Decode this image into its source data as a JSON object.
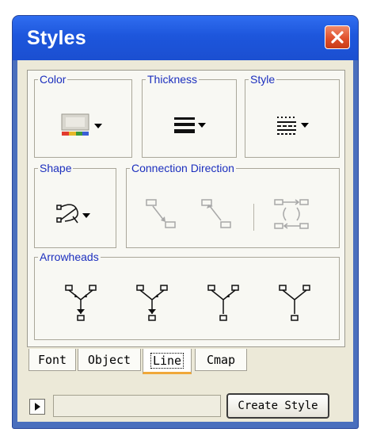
{
  "window": {
    "title": "Styles"
  },
  "groups": {
    "color": "Color",
    "thickness": "Thickness",
    "style": "Style",
    "shape": "Shape",
    "connection": "Connection Direction",
    "arrowheads": "Arrowheads"
  },
  "tabs": [
    {
      "label": "Font",
      "active": false
    },
    {
      "label": "Object",
      "active": false
    },
    {
      "label": "Line",
      "active": true
    },
    {
      "label": "Cmap",
      "active": false
    }
  ],
  "footer": {
    "style_name_value": "",
    "create_label": "Create Style"
  },
  "colors": {
    "titlebar": "#1d56dc",
    "legend_text": "#1c2fbe",
    "active_tab_underline": "#f0a83a",
    "close_button": "#e0502c"
  }
}
